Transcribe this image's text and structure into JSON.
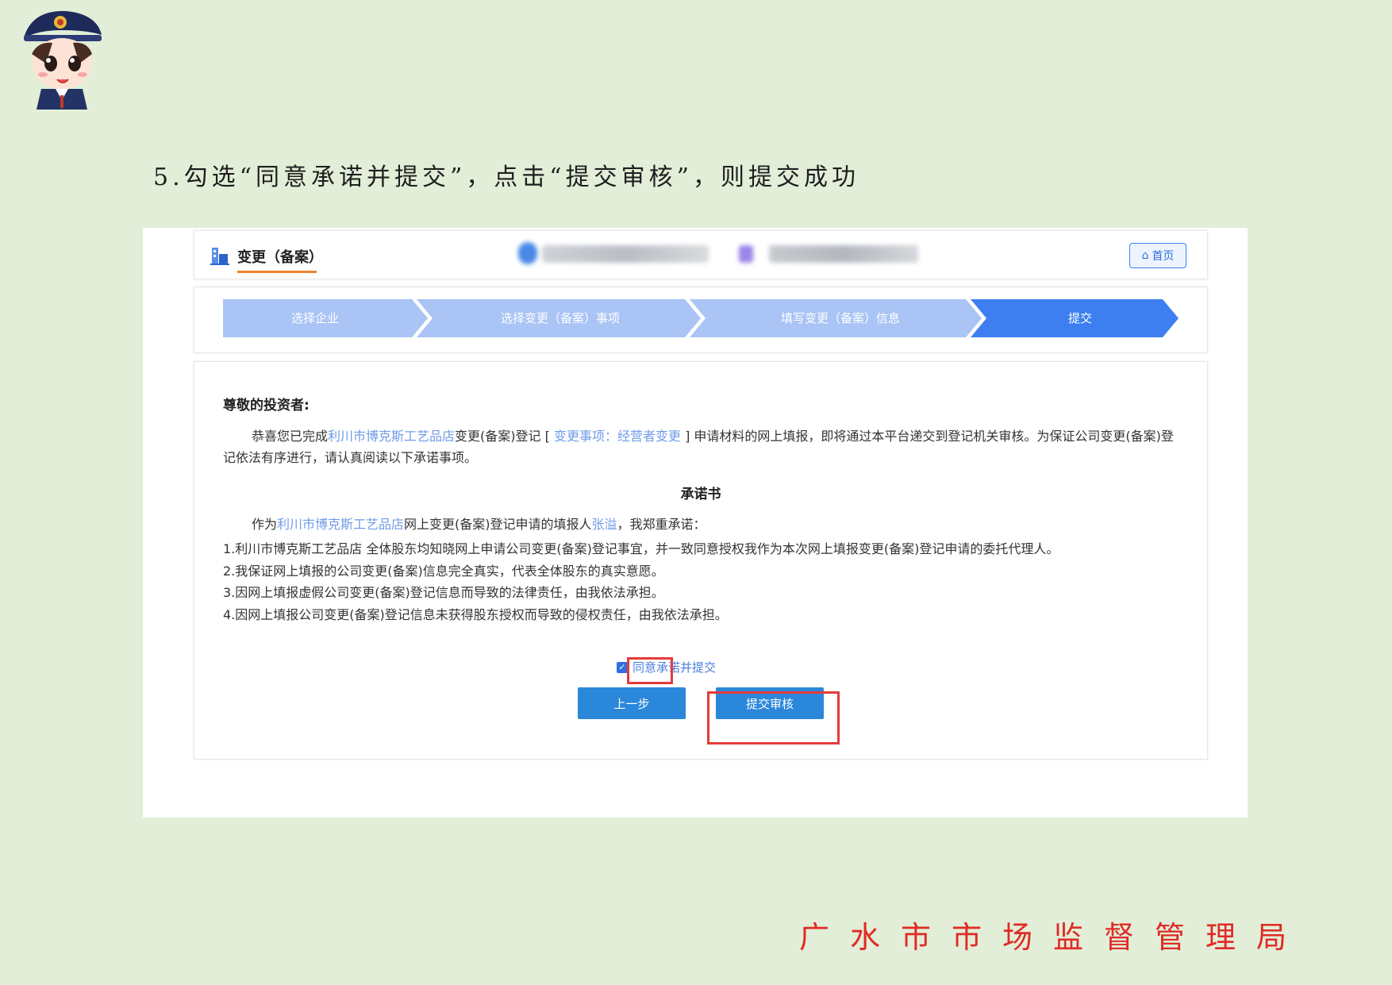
{
  "caption": "5.勾选“同意承诺并提交”，点击“提交审核”，则提交成功",
  "header": {
    "title": "变更（备案）",
    "home_label": "首页"
  },
  "steps": [
    "选择企业",
    "选择变更（备案）事项",
    "填写变更（备案）信息",
    "提交"
  ],
  "notice": {
    "greeting": "尊敬的投资者:",
    "intro_a": "恭喜您已完成",
    "company": "利川市博克斯工艺品店",
    "intro_b": "变更(备案)登记 [",
    "change_item": "变更事项：经营者变更",
    "intro_c": "] 申请材料的网上填报，即将通过本平台递交到登记机关审核。为保证公司变更(备案)登记依法有序进行，请认真阅读以下承诺事项。",
    "pledge_title": "承诺书",
    "pledge_a": "作为",
    "pledge_company": "利川市博克斯工艺品店",
    "pledge_b": "网上变更(备案)登记申请的填报人",
    "filer": "张溢",
    "pledge_c": "，我郑重承诺：",
    "items": [
      "1.利川市博克斯工艺品店 全体股东均知晓网上申请公司变更(备案)登记事宜，并一致同意授权我作为本次网上填报变更(备案)登记申请的委托代理人。",
      "2.我保证网上填报的公司变更(备案)信息完全真实，代表全体股东的真实意愿。",
      "3.因网上填报虚假公司变更(备案)登记信息而导致的法律责任，由我依法承担。",
      "4.因网上填报公司变更(备案)登记信息未获得股东授权而导致的侵权责任，由我依法承担。"
    ]
  },
  "agree_label": "同意承诺并提交",
  "buttons": {
    "prev": "上一步",
    "submit": "提交审核"
  },
  "footer_org": "广水市市场监督管理局",
  "colors": {
    "step_done": "#a9c4f5",
    "step_current": "#3d7ff0",
    "highlight": "#e53a3a",
    "page_bg": "#e2eed7"
  }
}
